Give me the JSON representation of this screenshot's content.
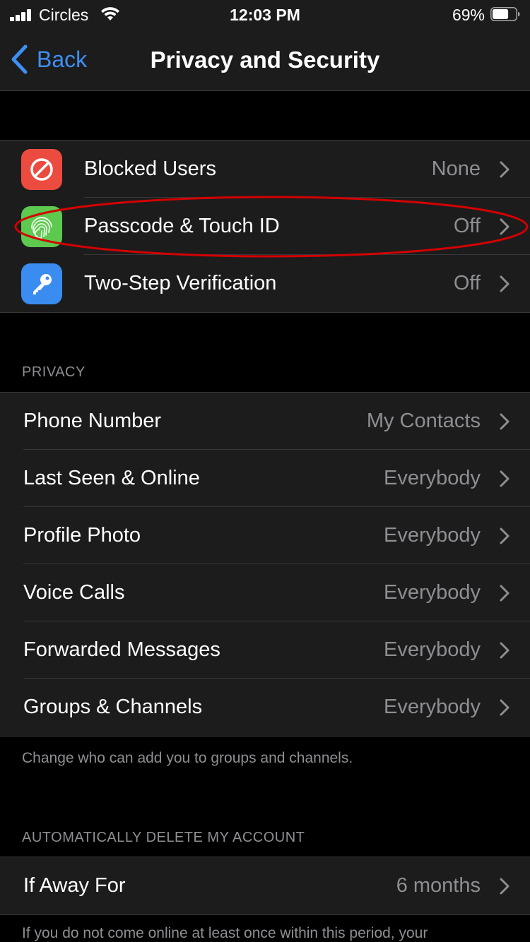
{
  "status_bar": {
    "carrier": "Circles",
    "time": "12:03 PM",
    "battery_percent": "69%",
    "battery_level": 0.69
  },
  "nav": {
    "back_label": "Back",
    "title": "Privacy and Security"
  },
  "security_group": [
    {
      "label": "Blocked Users",
      "value": "None",
      "icon": "blocked-icon",
      "color": "#eb4c3f"
    },
    {
      "label": "Passcode & Touch ID",
      "value": "Off",
      "icon": "fingerprint-icon",
      "color": "#5dc94f"
    },
    {
      "label": "Two-Step Verification",
      "value": "Off",
      "icon": "key-icon",
      "color": "#3b8cf0"
    }
  ],
  "privacy": {
    "header": "PRIVACY",
    "items": [
      {
        "label": "Phone Number",
        "value": "My Contacts"
      },
      {
        "label": "Last Seen & Online",
        "value": "Everybody"
      },
      {
        "label": "Profile Photo",
        "value": "Everybody"
      },
      {
        "label": "Voice Calls",
        "value": "Everybody"
      },
      {
        "label": "Forwarded Messages",
        "value": "Everybody"
      },
      {
        "label": "Groups & Channels",
        "value": "Everybody"
      }
    ],
    "footer": "Change who can add you to groups and channels."
  },
  "auto_delete": {
    "header": "AUTOMATICALLY DELETE MY ACCOUNT",
    "item": {
      "label": "If Away For",
      "value": "6 months"
    },
    "footer": "If you do not come online at least once within this period, your"
  },
  "colors": {
    "accent": "#3e8ff2",
    "annotation": "#d40000"
  }
}
